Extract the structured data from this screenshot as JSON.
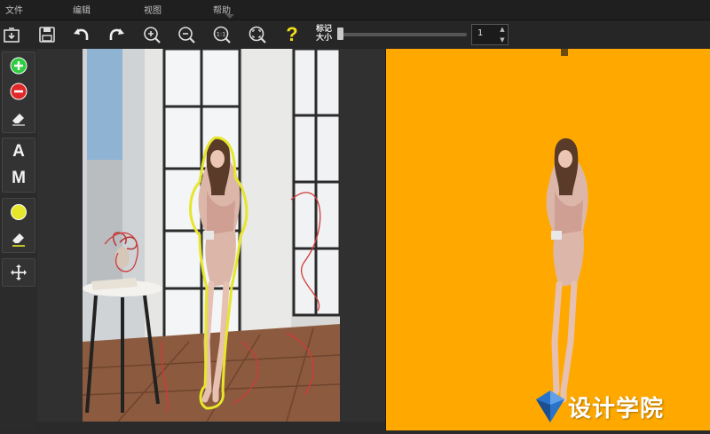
{
  "menu": {
    "file": "文件",
    "edit": "编辑",
    "view": "视图",
    "help": "帮助"
  },
  "toolbar": {
    "buttons": [
      "import-icon",
      "save-icon",
      "undo-icon",
      "redo-icon",
      "zoom-in-icon",
      "zoom-out-icon",
      "zoom-actual-icon",
      "zoom-fit-icon",
      "help-icon"
    ],
    "zoom_actual_text": "1:1",
    "help_text": "?",
    "marker_size_label_line1": "标记",
    "marker_size_label_line2": "大小",
    "marker_size_value": "1",
    "marker_size_slider_fraction": 0.0
  },
  "tools": {
    "add_foreground": "plus-green-icon",
    "remove_background": "minus-red-icon",
    "eraser": "eraser-icon",
    "auto_label": "A",
    "manual_label": "M",
    "color_marker": "yellow-dot-icon",
    "eraser_yellow": "eraser-yellow-icon",
    "move": "move-arrows-icon"
  },
  "colors": {
    "background_result": "#ffa900",
    "add_marker": "#2ecc40",
    "remove_marker": "#e02828",
    "edge_marker": "#e6e62a"
  },
  "watermark": {
    "text": "设计学院"
  }
}
